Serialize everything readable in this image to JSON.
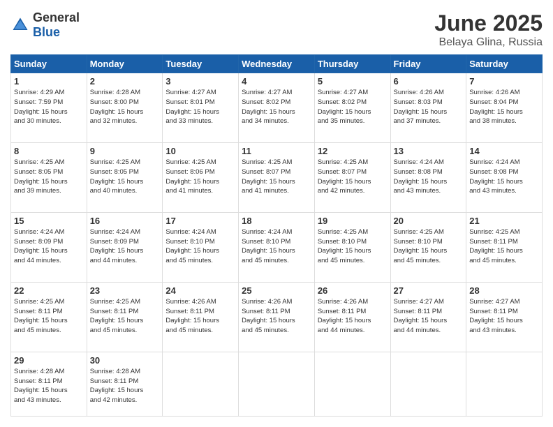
{
  "header": {
    "logo_general": "General",
    "logo_blue": "Blue",
    "title": "June 2025",
    "location": "Belaya Glina, Russia"
  },
  "days_of_week": [
    "Sunday",
    "Monday",
    "Tuesday",
    "Wednesday",
    "Thursday",
    "Friday",
    "Saturday"
  ],
  "weeks": [
    [
      {
        "num": "1",
        "sunrise": "4:29 AM",
        "sunset": "7:59 PM",
        "daylight": "15 hours and 30 minutes."
      },
      {
        "num": "2",
        "sunrise": "4:28 AM",
        "sunset": "8:00 PM",
        "daylight": "15 hours and 32 minutes."
      },
      {
        "num": "3",
        "sunrise": "4:27 AM",
        "sunset": "8:01 PM",
        "daylight": "15 hours and 33 minutes."
      },
      {
        "num": "4",
        "sunrise": "4:27 AM",
        "sunset": "8:02 PM",
        "daylight": "15 hours and 34 minutes."
      },
      {
        "num": "5",
        "sunrise": "4:27 AM",
        "sunset": "8:02 PM",
        "daylight": "15 hours and 35 minutes."
      },
      {
        "num": "6",
        "sunrise": "4:26 AM",
        "sunset": "8:03 PM",
        "daylight": "15 hours and 37 minutes."
      },
      {
        "num": "7",
        "sunrise": "4:26 AM",
        "sunset": "8:04 PM",
        "daylight": "15 hours and 38 minutes."
      }
    ],
    [
      {
        "num": "8",
        "sunrise": "4:25 AM",
        "sunset": "8:05 PM",
        "daylight": "15 hours and 39 minutes."
      },
      {
        "num": "9",
        "sunrise": "4:25 AM",
        "sunset": "8:05 PM",
        "daylight": "15 hours and 40 minutes."
      },
      {
        "num": "10",
        "sunrise": "4:25 AM",
        "sunset": "8:06 PM",
        "daylight": "15 hours and 41 minutes."
      },
      {
        "num": "11",
        "sunrise": "4:25 AM",
        "sunset": "8:07 PM",
        "daylight": "15 hours and 41 minutes."
      },
      {
        "num": "12",
        "sunrise": "4:25 AM",
        "sunset": "8:07 PM",
        "daylight": "15 hours and 42 minutes."
      },
      {
        "num": "13",
        "sunrise": "4:24 AM",
        "sunset": "8:08 PM",
        "daylight": "15 hours and 43 minutes."
      },
      {
        "num": "14",
        "sunrise": "4:24 AM",
        "sunset": "8:08 PM",
        "daylight": "15 hours and 43 minutes."
      }
    ],
    [
      {
        "num": "15",
        "sunrise": "4:24 AM",
        "sunset": "8:09 PM",
        "daylight": "15 hours and 44 minutes."
      },
      {
        "num": "16",
        "sunrise": "4:24 AM",
        "sunset": "8:09 PM",
        "daylight": "15 hours and 44 minutes."
      },
      {
        "num": "17",
        "sunrise": "4:24 AM",
        "sunset": "8:10 PM",
        "daylight": "15 hours and 45 minutes."
      },
      {
        "num": "18",
        "sunrise": "4:24 AM",
        "sunset": "8:10 PM",
        "daylight": "15 hours and 45 minutes."
      },
      {
        "num": "19",
        "sunrise": "4:25 AM",
        "sunset": "8:10 PM",
        "daylight": "15 hours and 45 minutes."
      },
      {
        "num": "20",
        "sunrise": "4:25 AM",
        "sunset": "8:10 PM",
        "daylight": "15 hours and 45 minutes."
      },
      {
        "num": "21",
        "sunrise": "4:25 AM",
        "sunset": "8:11 PM",
        "daylight": "15 hours and 45 minutes."
      }
    ],
    [
      {
        "num": "22",
        "sunrise": "4:25 AM",
        "sunset": "8:11 PM",
        "daylight": "15 hours and 45 minutes."
      },
      {
        "num": "23",
        "sunrise": "4:25 AM",
        "sunset": "8:11 PM",
        "daylight": "15 hours and 45 minutes."
      },
      {
        "num": "24",
        "sunrise": "4:26 AM",
        "sunset": "8:11 PM",
        "daylight": "15 hours and 45 minutes."
      },
      {
        "num": "25",
        "sunrise": "4:26 AM",
        "sunset": "8:11 PM",
        "daylight": "15 hours and 45 minutes."
      },
      {
        "num": "26",
        "sunrise": "4:26 AM",
        "sunset": "8:11 PM",
        "daylight": "15 hours and 44 minutes."
      },
      {
        "num": "27",
        "sunrise": "4:27 AM",
        "sunset": "8:11 PM",
        "daylight": "15 hours and 44 minutes."
      },
      {
        "num": "28",
        "sunrise": "4:27 AM",
        "sunset": "8:11 PM",
        "daylight": "15 hours and 43 minutes."
      }
    ],
    [
      {
        "num": "29",
        "sunrise": "4:28 AM",
        "sunset": "8:11 PM",
        "daylight": "15 hours and 43 minutes."
      },
      {
        "num": "30",
        "sunrise": "4:28 AM",
        "sunset": "8:11 PM",
        "daylight": "15 hours and 42 minutes."
      },
      null,
      null,
      null,
      null,
      null
    ]
  ]
}
